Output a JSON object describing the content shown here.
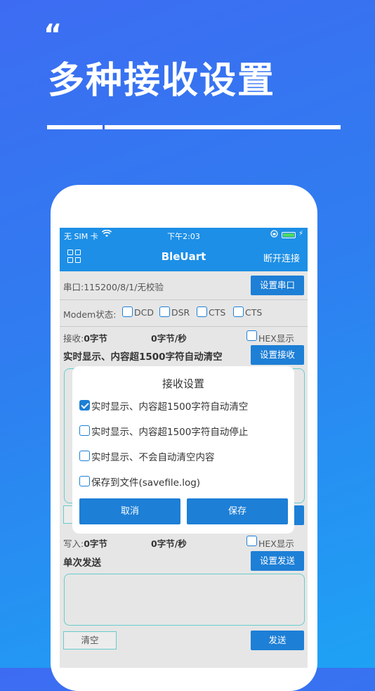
{
  "promo": {
    "quote_mark": "“",
    "headline": "多种接收设置"
  },
  "status_bar": {
    "carrier": "无 SIM 卡",
    "time": "下午2:03",
    "wifi_icon": "wifi-icon",
    "battery_icon": "battery-icon"
  },
  "nav": {
    "title": "BleUart",
    "disconnect": "断开连接",
    "menu_icon": "grid-icon"
  },
  "serial": {
    "label": "串口:",
    "value": "115200/8/1/无校验",
    "button": "设置串口"
  },
  "modem": {
    "label": "Modem状态:",
    "signals": [
      "DCD",
      "DSR",
      "CTS",
      "CTS"
    ]
  },
  "receive": {
    "bytes_label": "接收:",
    "bytes_value": "0字节",
    "rate": "0字节/秒",
    "hex": "HEX显示",
    "mode": "实时显示、内容超1500字符自动清空",
    "button": "设置接收"
  },
  "write": {
    "bytes_label": "写入:",
    "bytes_value": "0字节",
    "rate": "0字节/秒",
    "hex": "HEX显示",
    "mode": "单次发送",
    "button": "设置发送",
    "clear": "清空",
    "send": "发送"
  },
  "dialog": {
    "title": "接收设置",
    "options": [
      {
        "label": "实时显示、内容超1500字符自动清空",
        "checked": true
      },
      {
        "label": "实时显示、内容超1500字符自动停止",
        "checked": false
      },
      {
        "label": "实时显示、不会自动清空内容",
        "checked": false
      },
      {
        "label": "保存到文件(savefile.log)",
        "checked": false
      }
    ],
    "cancel": "取消",
    "save": "保存"
  },
  "colors": {
    "accent": "#1d7fd6",
    "navbar": "#1d8fe6",
    "background_start": "#3d6cf2",
    "background_end": "#1ea2f4"
  }
}
